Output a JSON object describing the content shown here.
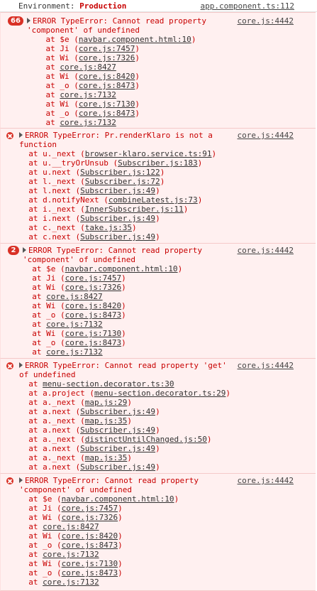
{
  "top": {
    "env_label": "Environment:",
    "env_value": "Production",
    "source": "app.component.ts:112"
  },
  "entries": [
    {
      "count": "66",
      "source": "core.js:4442",
      "title_lines": [
        "ERROR TypeError: Cannot read property",
        "'component' of undefined"
      ],
      "frames": [
        {
          "fn": "$e",
          "loc": "navbar.component.html:10",
          "paren": true
        },
        {
          "fn": "Ji",
          "loc": "core.js:7457",
          "paren": true
        },
        {
          "fn": "Wi",
          "loc": "core.js:7326",
          "paren": true
        },
        {
          "fn": "",
          "loc": "core.js:8427",
          "paren": false
        },
        {
          "fn": "Wi",
          "loc": "core.js:8420",
          "paren": true
        },
        {
          "fn": "_o",
          "loc": "core.js:8473",
          "paren": true
        },
        {
          "fn": "",
          "loc": "core.js:7132",
          "paren": false
        },
        {
          "fn": "Wi",
          "loc": "core.js:7130",
          "paren": true
        },
        {
          "fn": "_o",
          "loc": "core.js:8473",
          "paren": true
        },
        {
          "fn": "",
          "loc": "core.js:7132",
          "paren": false
        }
      ]
    },
    {
      "count": "",
      "source": "core.js:4442",
      "title_lines": [
        "ERROR TypeError: Pr.renderKlaro is not a",
        "function"
      ],
      "frames": [
        {
          "fn": "u._next",
          "loc": "browser-klaro.service.ts:91",
          "paren": true
        },
        {
          "fn": "u.__tryOrUnsub",
          "loc": "Subscriber.js:183",
          "paren": true
        },
        {
          "fn": "u.next",
          "loc": "Subscriber.js:122",
          "paren": true
        },
        {
          "fn": "l._next",
          "loc": "Subscriber.js:72",
          "paren": true
        },
        {
          "fn": "l.next",
          "loc": "Subscriber.js:49",
          "paren": true
        },
        {
          "fn": "d.notifyNext",
          "loc": "combineLatest.js:73",
          "paren": true
        },
        {
          "fn": "i._next",
          "loc": "InnerSubscriber.js:11",
          "paren": true
        },
        {
          "fn": "i.next",
          "loc": "Subscriber.js:49",
          "paren": true
        },
        {
          "fn": "c._next",
          "loc": "take.js:35",
          "paren": true
        },
        {
          "fn": "c.next",
          "loc": "Subscriber.js:49",
          "paren": true
        }
      ]
    },
    {
      "count": "2",
      "source": "core.js:4442",
      "title_lines": [
        "ERROR TypeError: Cannot read property",
        "'component' of undefined"
      ],
      "frames": [
        {
          "fn": "$e",
          "loc": "navbar.component.html:10",
          "paren": true
        },
        {
          "fn": "Ji",
          "loc": "core.js:7457",
          "paren": true
        },
        {
          "fn": "Wi",
          "loc": "core.js:7326",
          "paren": true
        },
        {
          "fn": "",
          "loc": "core.js:8427",
          "paren": false
        },
        {
          "fn": "Wi",
          "loc": "core.js:8420",
          "paren": true
        },
        {
          "fn": "_o",
          "loc": "core.js:8473",
          "paren": true
        },
        {
          "fn": "",
          "loc": "core.js:7132",
          "paren": false
        },
        {
          "fn": "Wi",
          "loc": "core.js:7130",
          "paren": true
        },
        {
          "fn": "_o",
          "loc": "core.js:8473",
          "paren": true
        },
        {
          "fn": "",
          "loc": "core.js:7132",
          "paren": false
        }
      ]
    },
    {
      "count": "",
      "source": "core.js:4442",
      "title_lines": [
        "ERROR TypeError: Cannot read property 'get'",
        "of undefined"
      ],
      "frames": [
        {
          "fn": "",
          "loc": "menu-section.decorator.ts:30",
          "paren": false
        },
        {
          "fn": "a.project",
          "loc": "menu-section.decorator.ts:29",
          "paren": true
        },
        {
          "fn": "a._next",
          "loc": "map.js:29",
          "paren": true
        },
        {
          "fn": "a.next",
          "loc": "Subscriber.js:49",
          "paren": true
        },
        {
          "fn": "a._next",
          "loc": "map.js:35",
          "paren": true
        },
        {
          "fn": "a.next",
          "loc": "Subscriber.js:49",
          "paren": true
        },
        {
          "fn": "a._next",
          "loc": "distinctUntilChanged.js:50",
          "paren": true
        },
        {
          "fn": "a.next",
          "loc": "Subscriber.js:49",
          "paren": true
        },
        {
          "fn": "a._next",
          "loc": "map.js:35",
          "paren": true
        },
        {
          "fn": "a.next",
          "loc": "Subscriber.js:49",
          "paren": true
        }
      ]
    },
    {
      "count": "",
      "source": "core.js:4442",
      "title_lines": [
        "ERROR TypeError: Cannot read property",
        "'component' of undefined"
      ],
      "frames": [
        {
          "fn": "$e",
          "loc": "navbar.component.html:10",
          "paren": true
        },
        {
          "fn": "Ji",
          "loc": "core.js:7457",
          "paren": true
        },
        {
          "fn": "Wi",
          "loc": "core.js:7326",
          "paren": true
        },
        {
          "fn": "",
          "loc": "core.js:8427",
          "paren": false
        },
        {
          "fn": "Wi",
          "loc": "core.js:8420",
          "paren": true
        },
        {
          "fn": "_o",
          "loc": "core.js:8473",
          "paren": true
        },
        {
          "fn": "",
          "loc": "core.js:7132",
          "paren": false
        },
        {
          "fn": "Wi",
          "loc": "core.js:7130",
          "paren": true
        },
        {
          "fn": "_o",
          "loc": "core.js:8473",
          "paren": true
        },
        {
          "fn": "",
          "loc": "core.js:7132",
          "paren": false
        }
      ]
    }
  ]
}
